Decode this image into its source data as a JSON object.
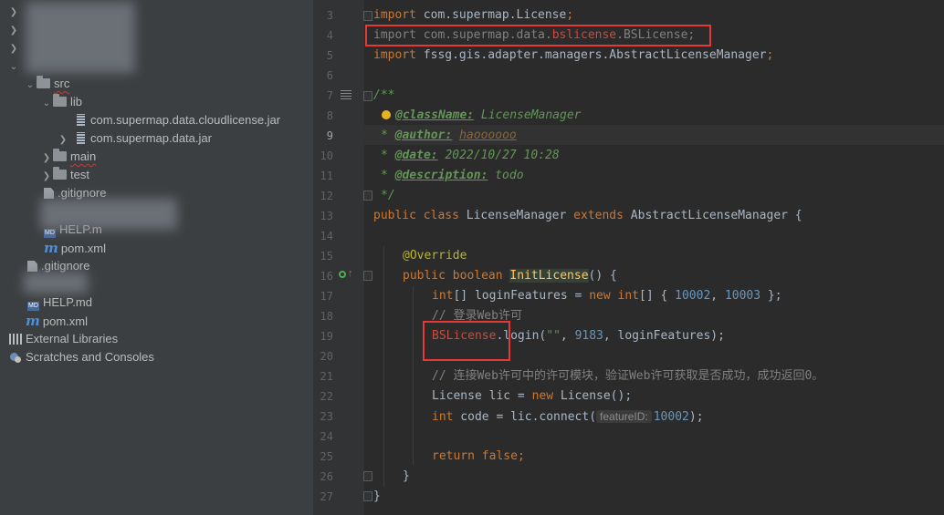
{
  "tree": {
    "items": [
      {
        "label": "src"
      },
      {
        "label": "lib"
      },
      {
        "label": "com.supermap.data.cloudlicense.jar"
      },
      {
        "label": "com.supermap.data.jar"
      },
      {
        "label": "main"
      },
      {
        "label": "test"
      },
      {
        "label": ".gitignore"
      },
      {
        "label": "HELP.m"
      },
      {
        "label": "pom.xml"
      },
      {
        "label": ".gitignore"
      },
      {
        "label": "HELP.md"
      },
      {
        "label": "pom.xml"
      },
      {
        "label": "External Libraries"
      },
      {
        "label": "Scratches and Consoles"
      }
    ]
  },
  "editor": {
    "line_numbers": [
      "3",
      "4",
      "5",
      "6",
      "7",
      "8",
      "9",
      "10",
      "11",
      "12",
      "13",
      "14",
      "15",
      "16",
      "17",
      "18",
      "19",
      "20",
      "21",
      "22",
      "23",
      "24",
      "25",
      "26",
      "27"
    ],
    "current_line": "9",
    "imports": {
      "l3_kw": "import",
      "l3_rest": " com.supermap.License",
      "l4_kw": "import",
      "l4_pre": " com.supermap.data.",
      "l4_pkg": "bslicense",
      "l4_post": ".BSLicense",
      "l5_kw": "import",
      "l5_rest": " fssg.gis.adapter.managers.AbstractLicenseManager"
    },
    "doc": {
      "open": "/**",
      "star": "* ",
      "class_tag": "@className:",
      "class_val": " LicenseManager",
      "author_tag": "@author:",
      "author_val": "haoooooo",
      "date_tag": "@date:",
      "date_val": " 2022/10/27 10:28",
      "desc_tag": "@description:",
      "desc_val": " todo",
      "close": "*/"
    },
    "class_decl": {
      "kw1": "public",
      "kw2": "class",
      "name": "LicenseManager",
      "kw3": "extends",
      "parent": "AbstractLicenseManager",
      "brace": " {"
    },
    "method": {
      "annotation": "@Override",
      "kw1": "public",
      "kw2": "boolean",
      "name": "InitLicense",
      "sig_end": "() {"
    },
    "body": {
      "l17_type": "int",
      "l17_a": "[] loginFeatures = ",
      "l17_new": "new",
      "l17_type2": " int",
      "l17_b": "[] { ",
      "l17_n1": "10002",
      "l17_c": ", ",
      "l17_n2": "10003",
      "l17_d": " };",
      "l18_comment": "// 登录Web许可",
      "l19_cls": "BSLicense",
      "l19_a": ".login(",
      "l19_str": "\"\"",
      "l19_b": ", ",
      "l19_num": "9183",
      "l19_c": ", loginFeatures);",
      "l21_comment": "// 连接Web许可中的许可模块，验证Web许可获取是否成功，成功返回0。",
      "l22_a": "License lic = ",
      "l22_new": "new",
      "l22_b": " License();",
      "l23_type": "int",
      "l23_a": " code = lic.connect(",
      "l23_hint": "featureID:",
      "l23_num": "10002",
      "l23_b": ");",
      "l25_kw": "return",
      "l25_kw2": " false",
      "l25_end": ";",
      "l26": "}",
      "l27": "}"
    },
    "semicolon": ";"
  }
}
